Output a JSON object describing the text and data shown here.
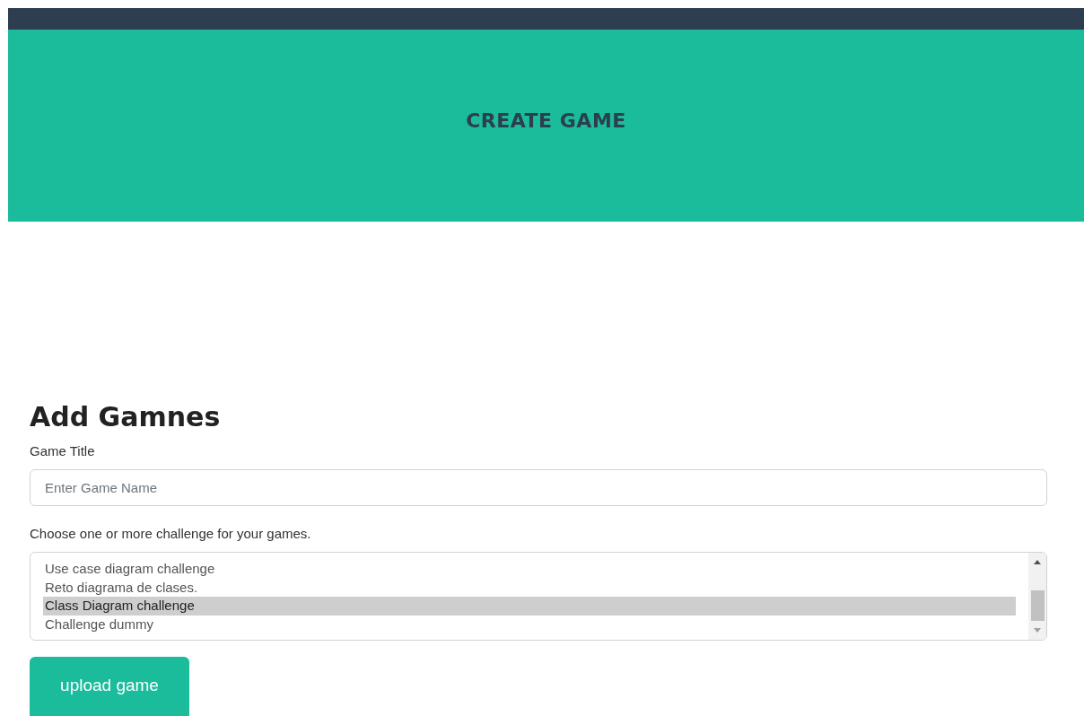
{
  "header": {
    "title": "CREATE GAME"
  },
  "form": {
    "heading": "Add Gamnes",
    "title_label": "Game Title",
    "title_field": {
      "placeholder": "Enter Game Name"
    },
    "challenges_label": "Choose one or more challenge for your games.",
    "challenges": [
      {
        "label": "Use case diagram challenge",
        "selected": false
      },
      {
        "label": "Reto diagrama de clases.",
        "selected": false
      },
      {
        "label": "Class Diagram challenge",
        "selected": true
      },
      {
        "label": "Challenge dummy",
        "selected": false
      }
    ],
    "submit": "upload game"
  }
}
